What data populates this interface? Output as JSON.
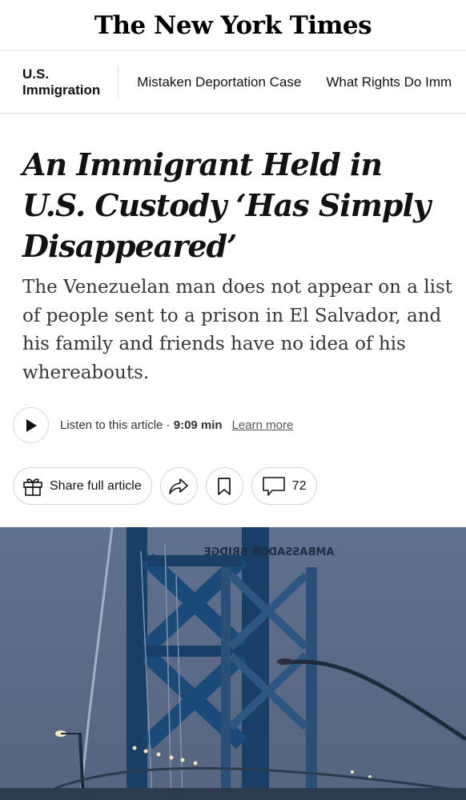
{
  "masthead": {
    "logo": "The New York Times"
  },
  "subnav": {
    "section_line1": "U.S.",
    "section_line2": "Immigration",
    "links": [
      "Mistaken Deportation Case",
      "What Rights Do Imm"
    ]
  },
  "article": {
    "headline": "An Immigrant Held in U.S. Custody ‘Has Simply Disappeared’",
    "summary": "The Venezuelan man does not appear on a list of people sent to a prison in El Salvador, and his family and friends have no idea of his whereabouts."
  },
  "audio": {
    "listen_label": "Listen to this article · ",
    "duration": "9:09 min",
    "learn_more": "Learn more",
    "icon": "play-icon"
  },
  "actions": {
    "share_label": "Share full article",
    "comment_count": "72",
    "icons": [
      "gift-icon",
      "share-arrow-icon",
      "bookmark-icon",
      "comment-icon"
    ]
  },
  "photo": {
    "sign_text": "AMBASSADOR BRIDGE",
    "colors": {
      "sky": "#5f6d8f",
      "steel": "#14416e"
    }
  }
}
